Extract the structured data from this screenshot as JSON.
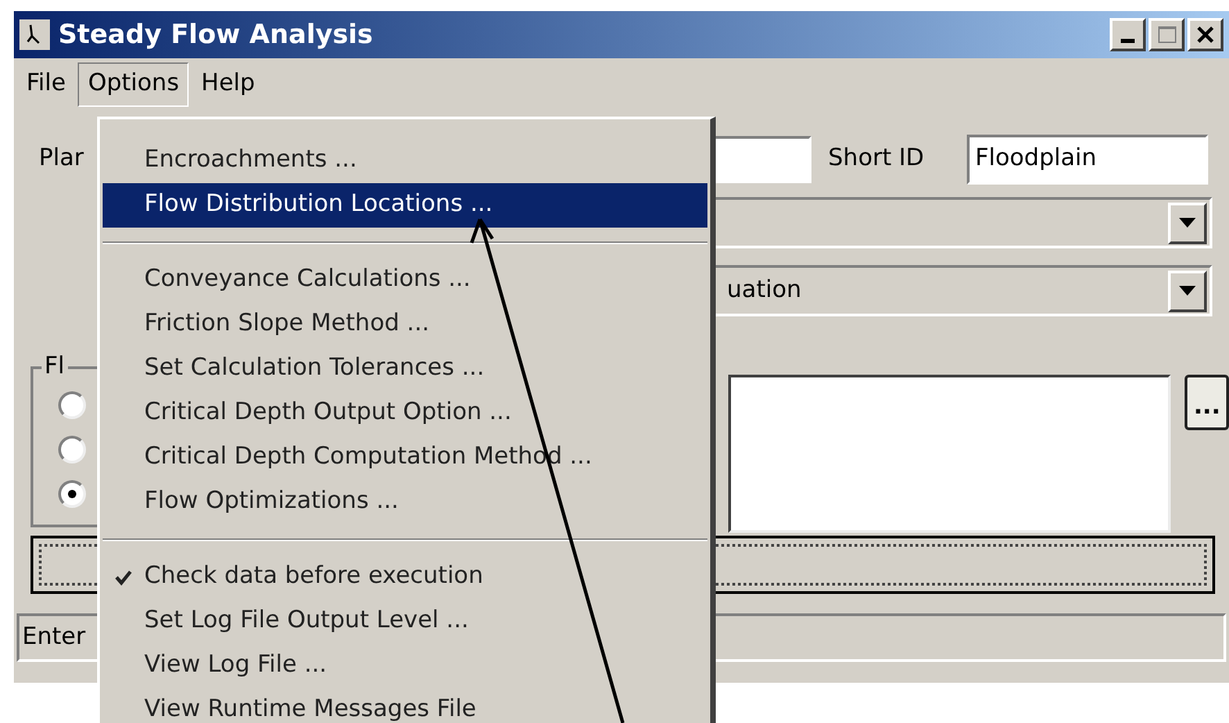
{
  "window": {
    "title": "Steady Flow Analysis"
  },
  "menu_bar": [
    {
      "label": "File",
      "selected": false
    },
    {
      "label": "Options",
      "selected": true
    },
    {
      "label": "Help",
      "selected": false
    }
  ],
  "plan_label": "Plar",
  "short_id": {
    "label": "Short ID",
    "value": "Floodplain"
  },
  "combo_2": {
    "value": "uation"
  },
  "group": {
    "label": "Fl",
    "radios": [
      {
        "selected": false
      },
      {
        "selected": false
      },
      {
        "selected": true
      }
    ]
  },
  "browse_button": "...",
  "status_bar": "Enter",
  "options_menu": [
    {
      "kind": "item",
      "label": "Encroachments ...",
      "selected": false,
      "checked": false
    },
    {
      "kind": "item",
      "label": "Flow Distribution Locations ...",
      "selected": true,
      "checked": false
    },
    {
      "kind": "separator"
    },
    {
      "kind": "item",
      "label": "Conveyance Calculations ...",
      "selected": false,
      "checked": false
    },
    {
      "kind": "item",
      "label": "Friction Slope Method ...",
      "selected": false,
      "checked": false
    },
    {
      "kind": "item",
      "label": "Set Calculation Tolerances ...",
      "selected": false,
      "checked": false
    },
    {
      "kind": "item",
      "label": "Critical Depth Output Option ...",
      "selected": false,
      "checked": false
    },
    {
      "kind": "item",
      "label": "Critical Depth Computation Method ...",
      "selected": false,
      "checked": false
    },
    {
      "kind": "item",
      "label": "Flow Optimizations ...",
      "selected": false,
      "checked": false
    },
    {
      "kind": "separator"
    },
    {
      "kind": "item",
      "label": "Check data before execution",
      "selected": false,
      "checked": true
    },
    {
      "kind": "item",
      "label": "Set Log File Output Level ...",
      "selected": false,
      "checked": false
    },
    {
      "kind": "item",
      "label": "View Log File ...",
      "selected": false,
      "checked": false
    },
    {
      "kind": "item",
      "label": "View Runtime Messages File",
      "selected": false,
      "checked": false
    }
  ]
}
